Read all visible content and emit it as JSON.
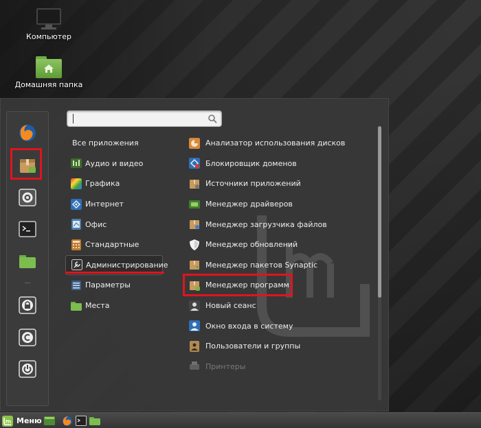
{
  "desktop": {
    "computer_label": "Компьютер",
    "home_label": "Домашняя папка"
  },
  "search": {
    "value": "",
    "placeholder": ""
  },
  "categories": [
    {
      "label": "Все приложения",
      "icon": "none"
    },
    {
      "label": "Аудио и видео",
      "icon": "multimedia-icon"
    },
    {
      "label": "Графика",
      "icon": "graphics-icon"
    },
    {
      "label": "Интернет",
      "icon": "internet-icon"
    },
    {
      "label": "Офис",
      "icon": "office-icon"
    },
    {
      "label": "Стандартные",
      "icon": "accessories-icon"
    },
    {
      "label": "Администрирование",
      "icon": "administration-icon",
      "selected": true
    },
    {
      "label": "Параметры",
      "icon": "preferences-icon"
    },
    {
      "label": "Места",
      "icon": "places-folder-icon"
    }
  ],
  "apps": [
    {
      "label": "Анализатор использования дисков",
      "icon": "disk-usage-icon"
    },
    {
      "label": "Блокировщик доменов",
      "icon": "domain-blocker-icon"
    },
    {
      "label": "Источники приложений",
      "icon": "software-sources-icon"
    },
    {
      "label": "Менеджер драйверов",
      "icon": "driver-manager-icon"
    },
    {
      "label": "Менеджер загрузчика файлов",
      "icon": "upload-manager-icon"
    },
    {
      "label": "Менеджер обновлений",
      "icon": "update-shield-icon"
    },
    {
      "label": "Менеджер пакетов Synaptic",
      "icon": "synaptic-icon"
    },
    {
      "label": "Менеджер программ",
      "icon": "software-manager-icon"
    },
    {
      "label": "Новый сеанс",
      "icon": "new-session-icon"
    },
    {
      "label": "Окно входа в систему",
      "icon": "login-window-icon"
    },
    {
      "label": "Пользователи и группы",
      "icon": "users-groups-icon"
    },
    {
      "label": "Принтеры",
      "icon": "printers-icon"
    }
  ],
  "taskbar": {
    "menu_label": "Меню"
  },
  "colors": {
    "highlight": "#e0141e",
    "mint_green": "#8bc34a"
  }
}
